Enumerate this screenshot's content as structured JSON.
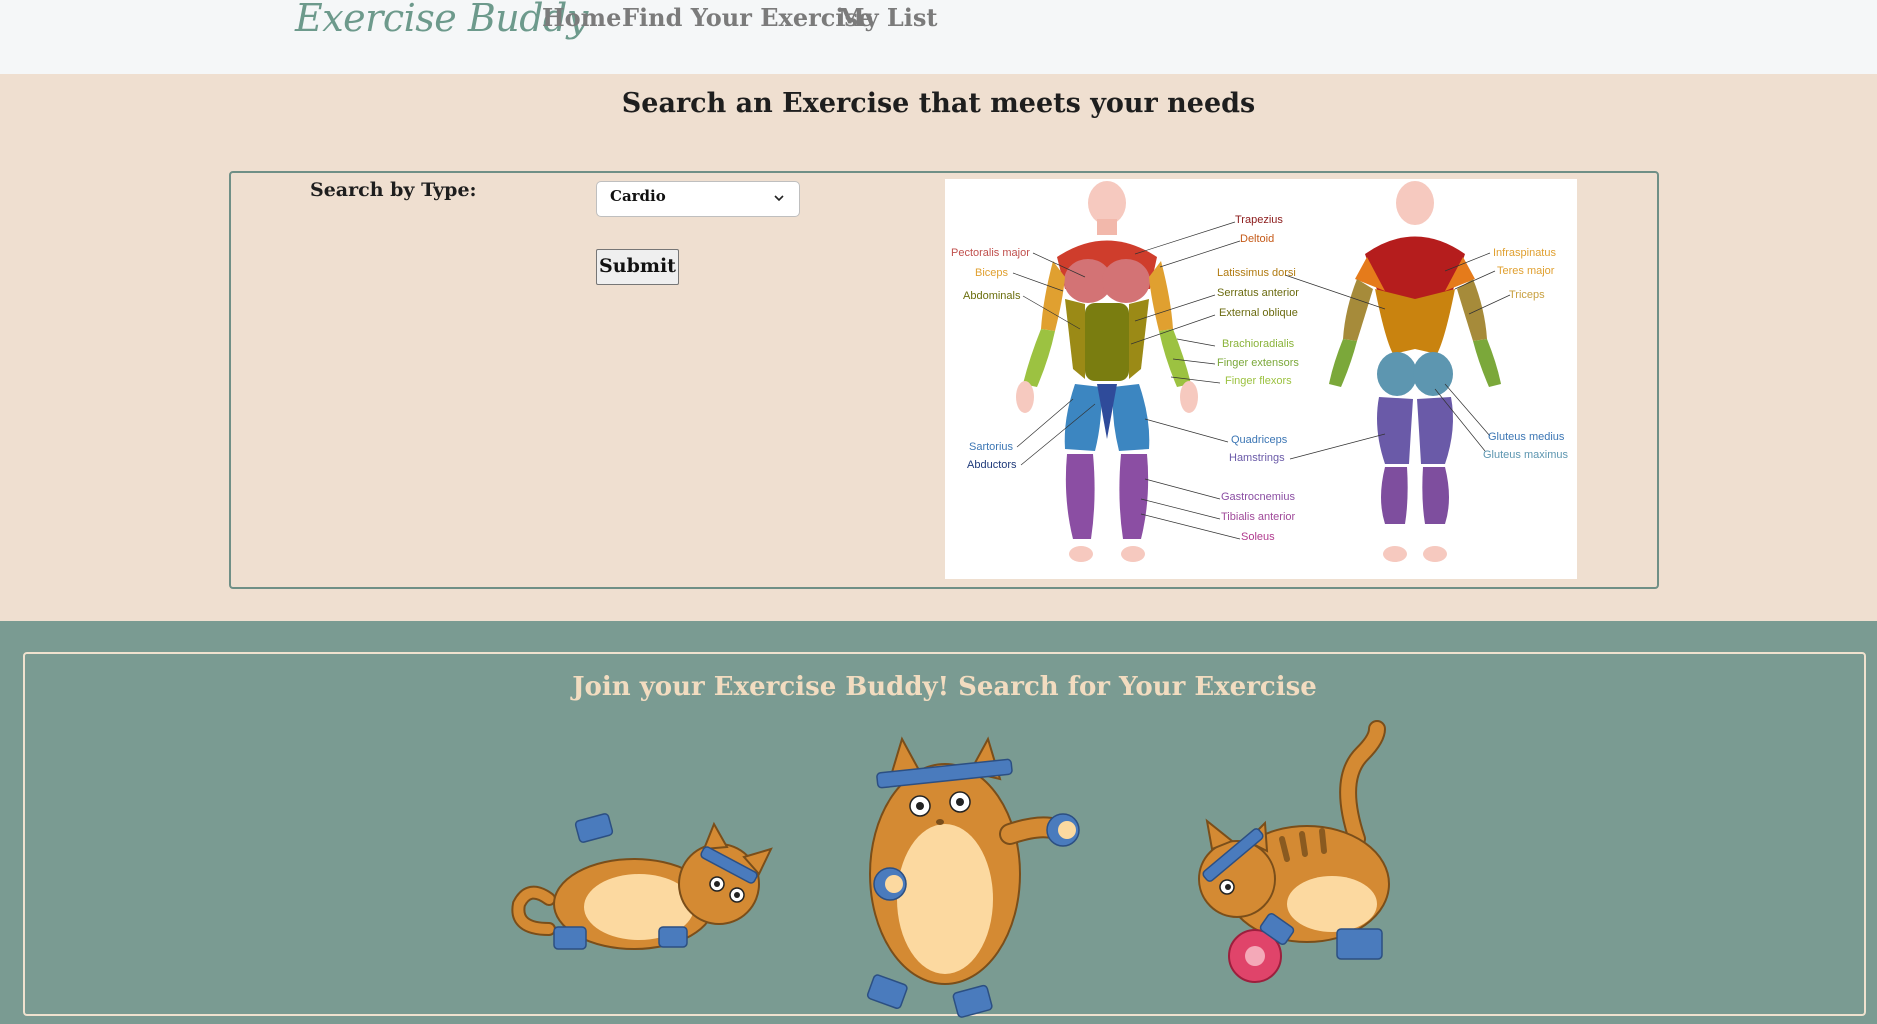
{
  "nav": {
    "brand": "Exercise Buddy",
    "links": [
      "Home",
      "Find Your Exercise",
      "My List"
    ]
  },
  "search": {
    "title": "Search an Exercise that meets your needs",
    "label": "Search by Type:",
    "select_value": "Cardio",
    "submit_label": "Submit"
  },
  "muscles": {
    "front_left": [
      "Pectoralis major",
      "Biceps",
      "Abdominals",
      "Sartorius",
      "Abductors"
    ],
    "center": [
      "Trapezius",
      "Deltoid",
      "Latissimus dorsi",
      "Serratus anterior",
      "External oblique",
      "Brachioradialis",
      "Finger extensors",
      "Finger flexors",
      "Quadriceps",
      "Hamstrings",
      "Gastrocnemius",
      "Tibialis anterior",
      "Soleus"
    ],
    "back_right": [
      "Infraspinatus",
      "Teres major",
      "Triceps",
      "Gluteus medius",
      "Gluteus maximus"
    ]
  },
  "join": {
    "title": "Join your Exercise Buddy! Search for Your Exercise"
  },
  "colors": {
    "nav_bg": "#f5f7f8",
    "brand": "#6d9a8c",
    "search_bg": "#efdfd0",
    "footer_bg": "#7a9b92",
    "join_title": "#f2dcc0",
    "cat_orange": "#d48a33",
    "cat_belly": "#fcd9a0",
    "band_blue": "#4a7bbd"
  }
}
